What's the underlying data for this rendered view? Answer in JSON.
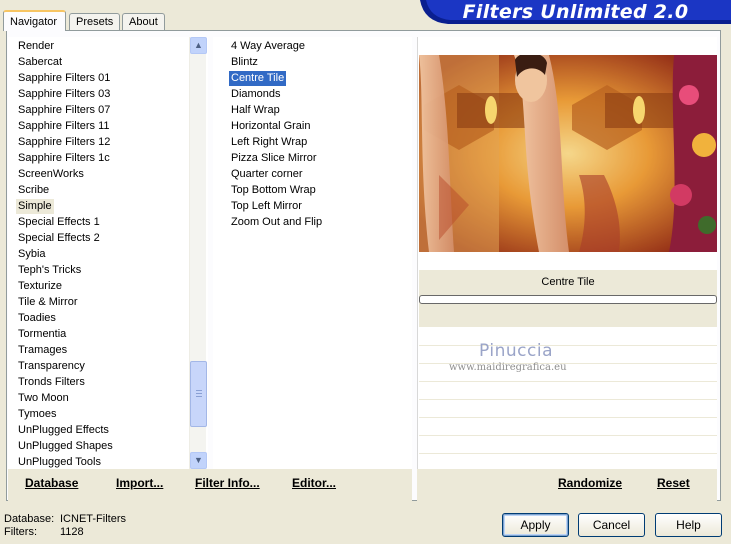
{
  "app": {
    "title": "Filters Unlimited 2.0"
  },
  "tabs": [
    {
      "label": "Navigator",
      "active": true
    },
    {
      "label": "Presets",
      "active": false
    },
    {
      "label": "About",
      "active": false
    }
  ],
  "categories": {
    "items": [
      "Render",
      "Sabercat",
      "Sapphire Filters 01",
      "Sapphire Filters 03",
      "Sapphire Filters 07",
      "Sapphire Filters 11",
      "Sapphire Filters 12",
      "Sapphire Filters 1c",
      "ScreenWorks",
      "Scribe",
      "Simple",
      "Special Effects 1",
      "Special Effects 2",
      "Sybia",
      "Teph's Tricks",
      "Texturize",
      "Tile & Mirror",
      "Toadies",
      "Tormentia",
      "Tramages",
      "Transparency",
      "Tronds Filters",
      "Two Moon",
      "Tymoes",
      "UnPlugged Effects",
      "UnPlugged Shapes",
      "UnPlugged Tools"
    ],
    "selected": "Simple",
    "scroll_position": 0.92
  },
  "filters": {
    "items": [
      "4 Way Average",
      "Blintz",
      "Centre Tile",
      "Diamonds",
      "Half Wrap",
      "Horizontal Grain",
      "Left Right Wrap",
      "Pizza Slice Mirror",
      "Quarter corner",
      "Top Bottom Wrap",
      "Top Left Mirror",
      "Zoom Out and Flip"
    ],
    "selected": "Centre Tile"
  },
  "preview": {
    "filter_name": "Centre Tile",
    "watermark_name": "Pinuccia",
    "watermark_url": "www.maidiregrafica.eu"
  },
  "toolbar": {
    "database": "Database",
    "import": "Import...",
    "filter_info": "Filter Info...",
    "editor": "Editor...",
    "randomize": "Randomize",
    "reset": "Reset"
  },
  "status": {
    "database_label": "Database:",
    "database_value": "ICNET-Filters",
    "filters_label": "Filters:",
    "filters_value": "1128"
  },
  "buttons": {
    "apply": "Apply",
    "cancel": "Cancel",
    "help": "Help"
  },
  "colors": {
    "selection": "#316ac5",
    "banner": "#0a1f8f",
    "dialog": "#ece9d8"
  }
}
